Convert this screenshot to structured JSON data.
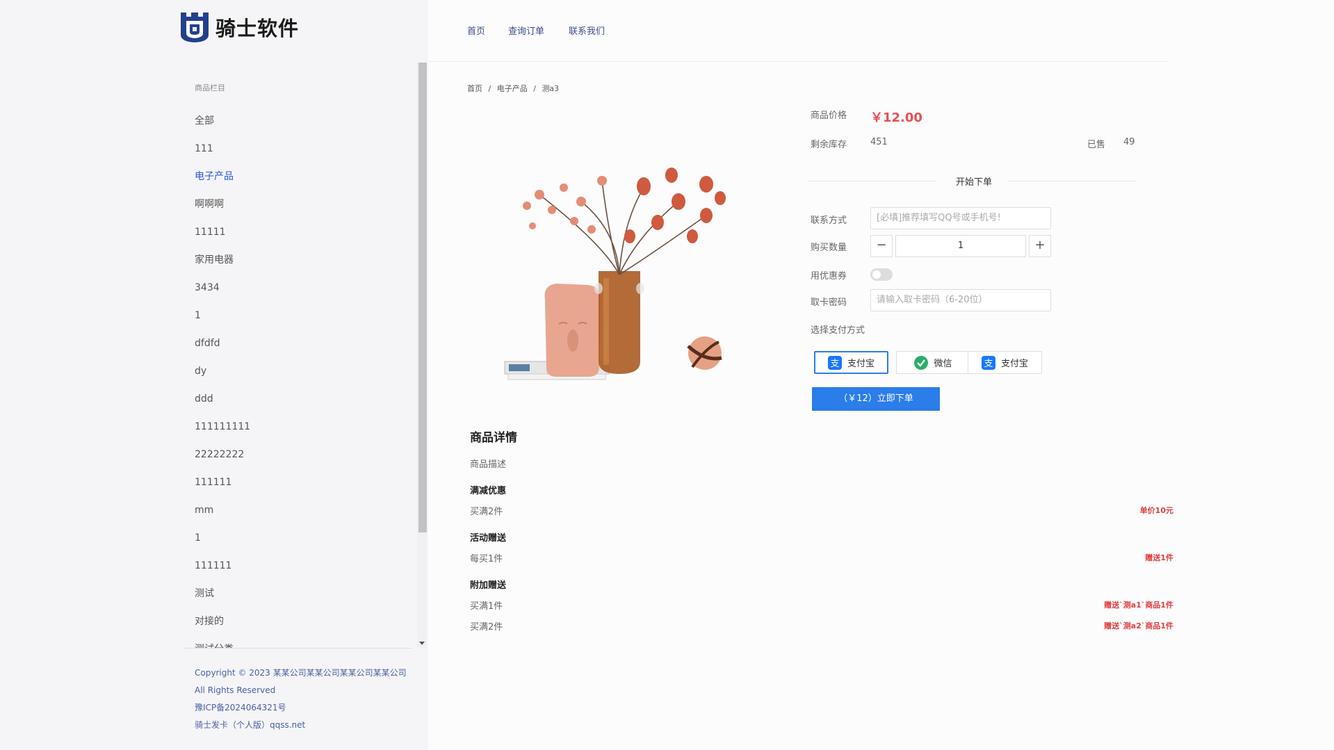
{
  "logo": {
    "text": "骑士软件"
  },
  "nav": {
    "items": [
      "首页",
      "查询订单",
      "联系我们"
    ]
  },
  "sidebar": {
    "title": "商品栏目",
    "items": [
      "全部",
      "111",
      "电子产品",
      "啊啊啊",
      "11111",
      "家用电器",
      "3434",
      "1",
      "dfdfd",
      "dy",
      "ddd",
      "111111111",
      "22222222",
      "111111",
      "mm",
      "1",
      "111111",
      "测试",
      "对接的",
      "测试分类"
    ],
    "active_index": 2
  },
  "footer": {
    "line1": "Copyright © 2023 某某公司某某公司某某公司某某公司",
    "line2": "All Rights Reserved",
    "line3": "豫ICP备2024064321号",
    "line4": "骑士发卡（个人版）qqss.net"
  },
  "breadcrumb": [
    "首页",
    "/",
    "电子产品",
    "/",
    "测a3"
  ],
  "order": {
    "price_label": "商品价格",
    "price": "￥12.00",
    "stock_label": "剩余库存",
    "stock": "451",
    "sold_label": "已售",
    "sold": "49",
    "start_label": "开始下单",
    "contact_label": "联系方式",
    "contact_placeholder": "[必填]推荐填写QQ号或手机号!",
    "qty_label": "购买数量",
    "qty_minus": "−",
    "qty_value": "1",
    "qty_plus": "+",
    "coupon_label": "用优惠券",
    "coupon_enabled": false,
    "card_pwd_label": "取卡密码",
    "card_pwd_placeholder": "请输入取卡密码（6-20位）",
    "pay_label": "选择支付方式",
    "pay_methods": [
      {
        "label": "支付宝",
        "icon": "alipay-icon",
        "color": "#1677ff",
        "selected": true
      },
      {
        "label": "微信",
        "icon": "wechat-icon",
        "color": "#2aae67",
        "selected": false
      },
      {
        "label": "支付宝",
        "icon": "alipay-icon",
        "color": "#1677ff",
        "selected": false
      }
    ],
    "submit_label": "（￥12）立即下单"
  },
  "details": {
    "title": "商品详情",
    "desc": "商品描述",
    "discount_title": "满减优惠",
    "discount_rule": "买满2件",
    "discount_value": "单价10元",
    "gift_title": "活动赠送",
    "gift_rule": "每买1件",
    "gift_value": "赠送1件",
    "extra_title": "附加赠送",
    "extra_rules": [
      {
        "rule": "买满1件",
        "value": "赠送`测a1`商品1件"
      },
      {
        "rule": "买满2件",
        "value": "赠送`测a2`商品1件"
      }
    ]
  },
  "colors": {
    "accent": "#2b7de9",
    "active_link": "#2b55d9",
    "price": "#e85050"
  }
}
